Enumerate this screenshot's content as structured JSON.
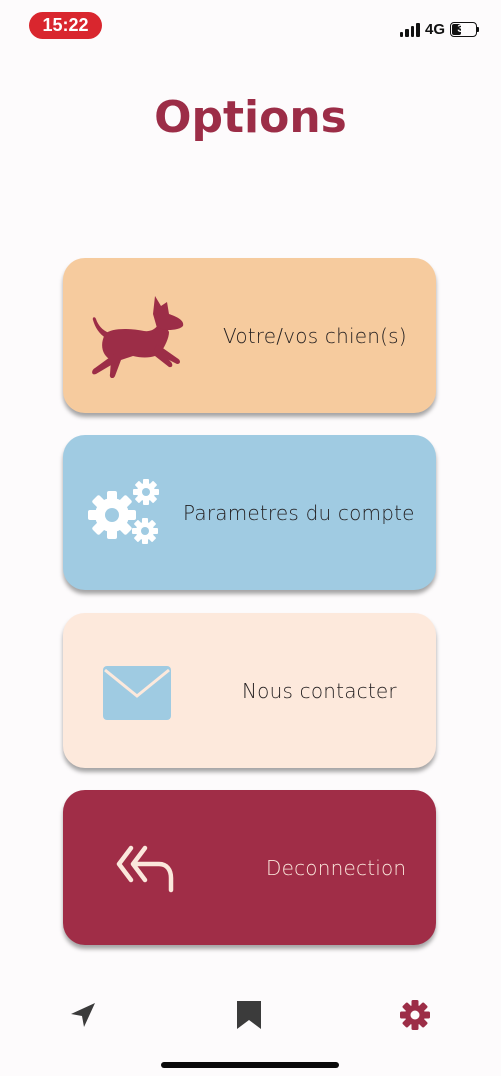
{
  "status_bar": {
    "time": "15:22",
    "network": "4G",
    "battery_level": "37",
    "time_badge_color": "#d9262e"
  },
  "header": {
    "title": "Options",
    "title_color": "#9c2d47"
  },
  "menu": {
    "items": [
      {
        "label": "Votre/vos chien(s)",
        "icon": "dog-icon",
        "color": "#f6cb9e"
      },
      {
        "label": "Parametres du compte",
        "icon": "gears-icon",
        "color": "#a0cbe2"
      },
      {
        "label": "Nous contacter",
        "icon": "envelope-icon",
        "color": "#fde9dc"
      },
      {
        "label": "Deconnection",
        "icon": "logout-arrow-icon",
        "color": "#a02d47"
      }
    ]
  },
  "tab_bar": {
    "tabs": [
      {
        "icon": "location-arrow-icon",
        "active": false
      },
      {
        "icon": "bookmark-icon",
        "active": false
      },
      {
        "icon": "gear-icon",
        "active": true
      }
    ],
    "active_color": "#9c2d47",
    "inactive_color": "#3b3b3b"
  }
}
